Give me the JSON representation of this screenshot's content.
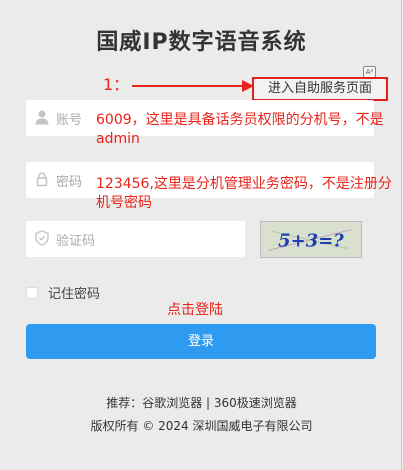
{
  "title": "国威IP数字语音系统",
  "ad_mark": "A²",
  "self_service": "进入自助服务页面",
  "username": {
    "placeholder": "账号"
  },
  "password": {
    "placeholder": "密码"
  },
  "captcha": {
    "placeholder": "验证码",
    "image_text": "5+3=?"
  },
  "remember_label": "记住密码",
  "login_label": "登录",
  "annotations": {
    "step": "1：",
    "username_note": "6009，这里是具备话务员权限的分机号，不是admin",
    "password_note": "123456,这里是分机管理业务密码，不是注册分机号密码",
    "login_note": "点击登陆"
  },
  "footer": {
    "browsers": "推荐：谷歌浏览器 | 360极速浏览器",
    "copyright": "版权所有 © 2024 深圳国威电子有限公司"
  },
  "colors": {
    "annotation": "#e8231a",
    "primary": "#2f9bf0",
    "background": "#ecebeb"
  },
  "icons": [
    "user-icon",
    "lock-icon",
    "shield-icon",
    "checkbox-icon"
  ]
}
